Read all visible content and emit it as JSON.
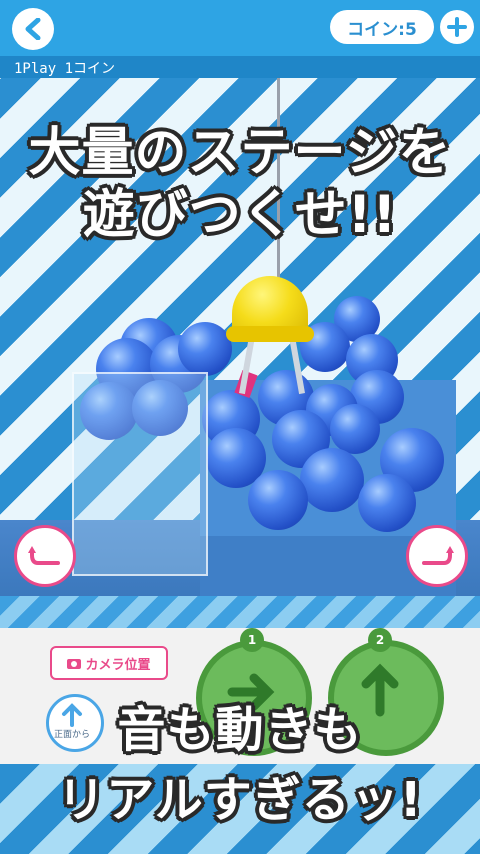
{
  "topbar": {
    "coin_label": "コイン:5",
    "info_text": "1Play  1コイン"
  },
  "headline": {
    "line1": "大量のステージを",
    "line2": "遊びつくせ!!",
    "line3": "音も動きも",
    "line4": "リアルすぎるッ!"
  },
  "panel": {
    "camera_label": "カメラ位置",
    "front_label": "正面から",
    "play1_number": "1",
    "play2_number": "2"
  },
  "colors": {
    "accent_blue": "#2ea4e4",
    "pink": "#e94a8a",
    "green": "#6cbb5c",
    "ball_blue": "#2350c7",
    "claw_yellow": "#f5dc1a"
  }
}
